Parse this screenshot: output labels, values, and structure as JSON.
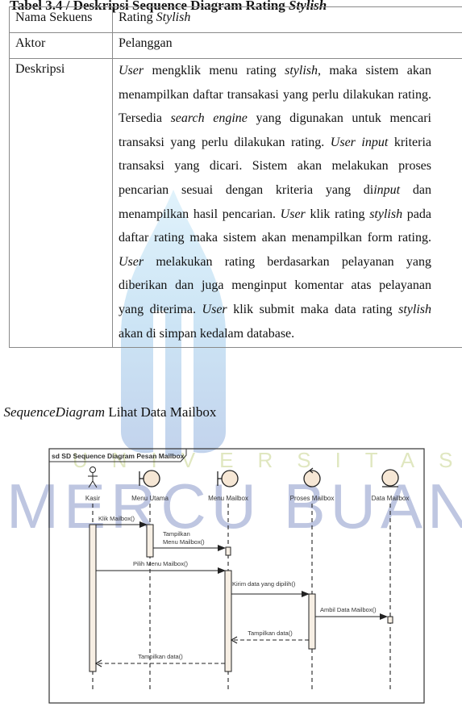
{
  "table": {
    "caption_prefix": "Tabel 3.4 / Deskripsi Sequence Diagram Rating ",
    "caption_italic": "Stylish",
    "rows": [
      {
        "key": "Nama Sekuens",
        "value_plain": "Rating ",
        "value_italic": "Stylish"
      },
      {
        "key": "Aktor",
        "value": "Pelanggan"
      },
      {
        "key": "Deskripsi"
      }
    ],
    "description_segments": [
      {
        "t": "User",
        "i": true
      },
      {
        "t": " mengklik menu rating ",
        "i": false
      },
      {
        "t": "stylish",
        "i": true
      },
      {
        "t": ", maka sistem akan menampilkan daftar transakasi yang perlu dilakukan rating. Tersedia ",
        "i": false
      },
      {
        "t": "search engine",
        "i": true
      },
      {
        "t": " yang digunakan untuk mencari transaksi yang perlu dilakukan rating. ",
        "i": false
      },
      {
        "t": "User input",
        "i": true
      },
      {
        "t": " kriteria transaksi yang dicari. Sistem akan melakukan proses pencarian  sesuai dengan kriteria yang di",
        "i": false
      },
      {
        "t": "input",
        "i": true
      },
      {
        "t": " dan menampilkan hasil pencarian. ",
        "i": false
      },
      {
        "t": "User",
        "i": true
      },
      {
        "t": " klik rating ",
        "i": false
      },
      {
        "t": "stylish",
        "i": true
      },
      {
        "t": " pada daftar rating maka sistem akan menampilkan form rating. ",
        "i": false
      },
      {
        "t": "User",
        "i": true
      },
      {
        "t": " melakukan rating berdasarkan pelayanan yang diberikan dan juga menginput komentar atas pelayanan yang diterima. ",
        "i": false
      },
      {
        "t": "User",
        "i": true
      },
      {
        "t": " klik submit maka data rating ",
        "i": false
      },
      {
        "t": "stylish",
        "i": true
      },
      {
        "t": " akan di simpan kedalam database.",
        "i": false
      }
    ]
  },
  "section": {
    "prefix": ". ",
    "italic": "SequenceDiagram",
    "title": " Lihat Data Mailbox"
  },
  "watermark": {
    "big": "MERCU BUANA",
    "small": "UNIVERSITAS"
  },
  "diagram": {
    "frame_title": "sd SD Sequence Diagram Pesan Mailbox",
    "lifelines": [
      {
        "name": "Kasir",
        "kind": "actor"
      },
      {
        "name": "Menu Utama",
        "kind": "boundary"
      },
      {
        "name": "Menu Mailbox",
        "kind": "boundary"
      },
      {
        "name": "Proses Mailbox",
        "kind": "control"
      },
      {
        "name": "Data Mailbox",
        "kind": "entity"
      }
    ],
    "messages": [
      {
        "from": 0,
        "to": 1,
        "label": "Klik Mailbox()",
        "type": "sync"
      },
      {
        "from": 1,
        "to": 2,
        "label_line1": "Tampilkan",
        "label": "Menu Mailbox()",
        "type": "sync"
      },
      {
        "from": 0,
        "to": 2,
        "label": "Pilih Menu Mailbox()",
        "type": "sync"
      },
      {
        "from": 2,
        "to": 3,
        "label": "Kirim data yang dipilih()",
        "type": "sync"
      },
      {
        "from": 3,
        "to": 4,
        "label": "Ambil Data Mailbox()",
        "type": "sync"
      },
      {
        "from": 3,
        "to": 2,
        "label": "Tampilkan data()",
        "type": "return"
      },
      {
        "from": 2,
        "to": 0,
        "label": "Tampilkan data()",
        "type": "return"
      }
    ],
    "colors": {
      "activation_fill": "#f7efe4",
      "icon_fill": "#f6e7d5",
      "line": "#222222"
    }
  }
}
